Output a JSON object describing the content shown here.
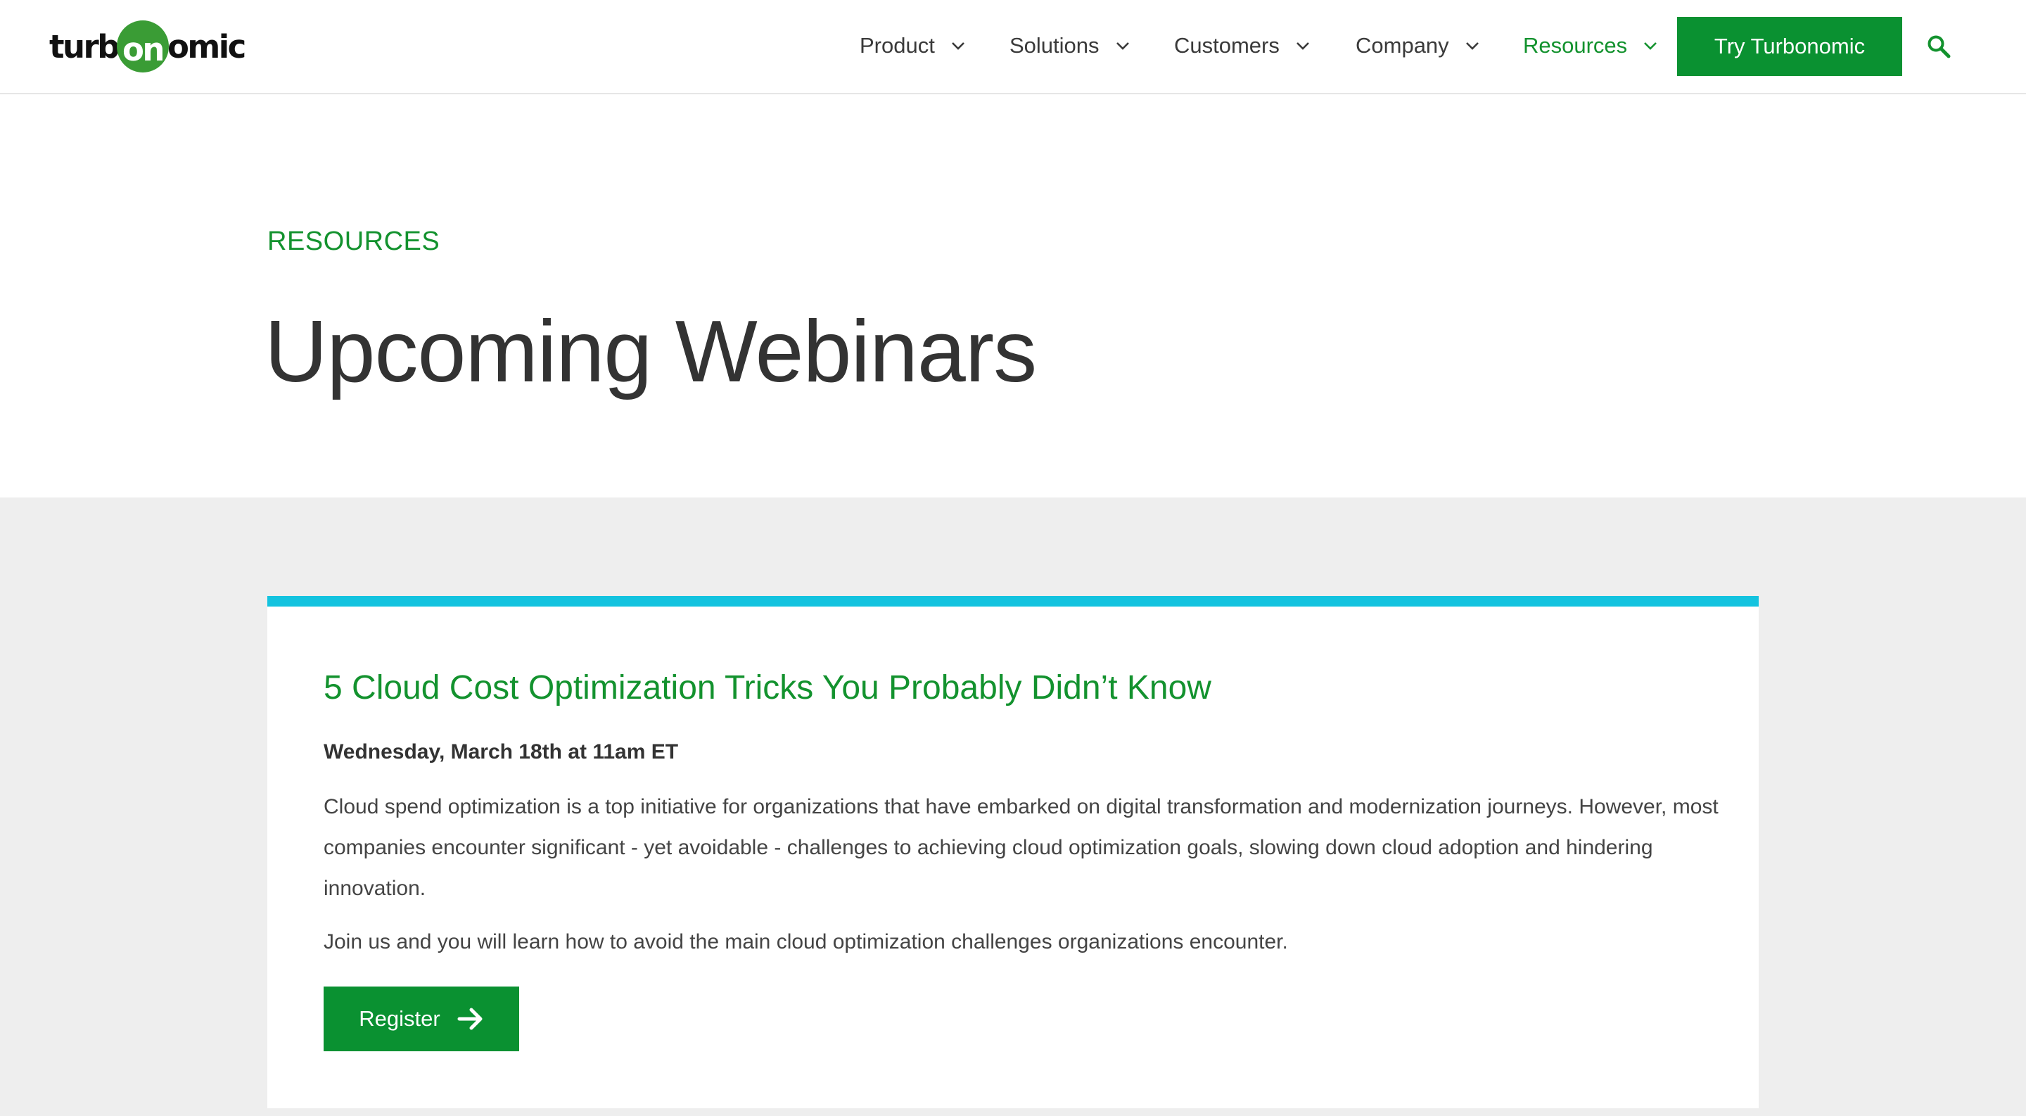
{
  "brand": {
    "logo_prefix": "turb",
    "logo_middle": "on",
    "logo_suffix": "omic",
    "logo_full": "turbonomic",
    "accent_color": "#0a9131",
    "highlight_color": "#13c3df"
  },
  "nav": {
    "items": [
      {
        "label": "Product",
        "active": false
      },
      {
        "label": "Solutions",
        "active": false
      },
      {
        "label": "Customers",
        "active": false
      },
      {
        "label": "Company",
        "active": false
      },
      {
        "label": "Resources",
        "active": true
      }
    ],
    "cta_label": "Try Turbonomic",
    "search_icon": "search-icon"
  },
  "hero": {
    "eyebrow": "RESOURCES",
    "title": "Upcoming Webinars"
  },
  "webinars": [
    {
      "title": "5 Cloud Cost Optimization Tricks You Probably Didn’t Know",
      "date": "Wednesday, March 18th at 11am ET",
      "description": "Cloud spend optimization is a top initiative for organizations that have embarked on digital transformation and modernization journeys. However, most companies encounter significant - yet avoidable - challenges to achieving cloud optimization goals, slowing down cloud adoption and hindering innovation.",
      "description2": "Join us and you will learn how to avoid the main cloud optimization challenges organizations encounter.",
      "button_label": "Register",
      "button_icon": "arrow-right-icon"
    }
  ]
}
